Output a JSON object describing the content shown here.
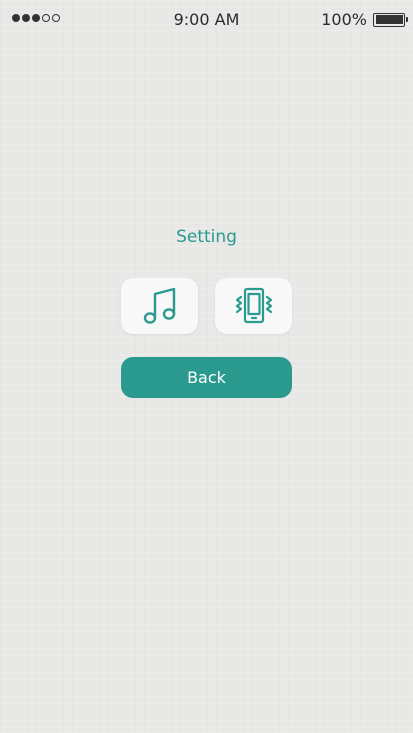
{
  "status_bar": {
    "signal_dots_filled": 3,
    "signal_dots_total": 5,
    "time": "9:00 AM",
    "battery_percent": "100%"
  },
  "settings": {
    "title": "Setting",
    "sound_icon": "music-note-icon",
    "vibration_icon": "phone-vibrate-icon"
  },
  "back_button": {
    "label": "Back"
  },
  "colors": {
    "accent": "#2a9a8f",
    "background": "#e8e8e6",
    "tile": "#f8f8f8"
  }
}
